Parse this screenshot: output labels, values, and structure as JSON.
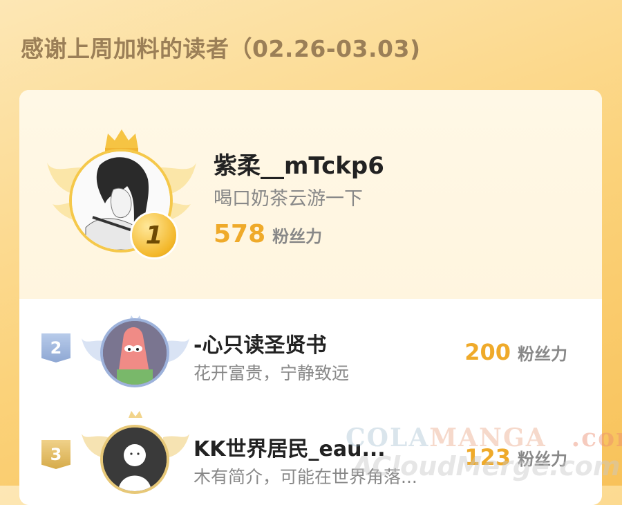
{
  "page": {
    "title": "感谢上周加料的读者（02.26-03.03)"
  },
  "top_reader": {
    "rank": "1",
    "name": "紫柔__mTckp6",
    "bio": "喝口奶茶云游一下",
    "fans_count": "578",
    "fans_unit": "粉丝力"
  },
  "readers": [
    {
      "rank": "2",
      "name": "-心只读圣贤书",
      "bio": "花开富贵，宁静致远",
      "fans_count": "200",
      "fans_unit": "粉丝力"
    },
    {
      "rank": "3",
      "name": "KK世界居民_eau...",
      "bio": "木有简介，可能在世界角落...",
      "fans_count": "123",
      "fans_unit": "粉丝力"
    }
  ],
  "watermark": {
    "line1_a": "COLA",
    "line1_b": "MANGA",
    "line1_c": ".com",
    "line2": "ACloudMerge.com"
  },
  "colors": {
    "accent": "#efaa2a",
    "title": "#9b7f57",
    "gold": "#f5c84a",
    "silver": "#8ea7d3",
    "bronze": "#d6ab4a"
  }
}
